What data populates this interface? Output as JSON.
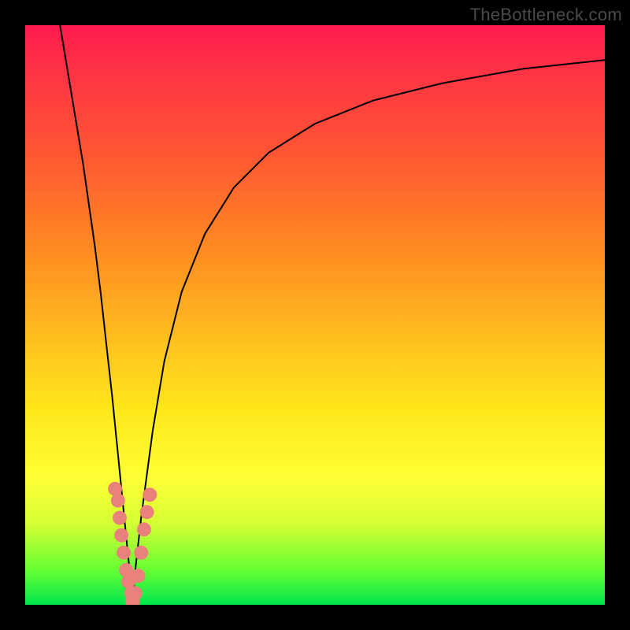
{
  "watermark": "TheBottleneck.com",
  "colors": {
    "gradient_top": "#ff1a4d",
    "gradient_mid1": "#ff8822",
    "gradient_mid2": "#ffe61a",
    "gradient_bottom": "#00e64d",
    "curve": "#000000",
    "marker": "#e8817c",
    "frame": "#000000"
  },
  "chart_data": {
    "type": "line",
    "title": "",
    "xlabel": "",
    "ylabel": "",
    "xlim": [
      0,
      100
    ],
    "ylim": [
      0,
      100
    ],
    "series": [
      {
        "name": "left-branch",
        "x": [
          6,
          8,
          10,
          12,
          13,
          14,
          15,
          16,
          17,
          18,
          18.5
        ],
        "values": [
          100,
          88,
          76,
          62,
          54,
          45,
          36,
          26,
          16,
          6,
          0
        ]
      },
      {
        "name": "right-branch",
        "x": [
          18.5,
          19,
          20,
          22,
          24,
          27,
          31,
          36,
          42,
          50,
          60,
          72,
          86,
          100
        ],
        "values": [
          0,
          6,
          15,
          30,
          42,
          54,
          64,
          72,
          78,
          83,
          87,
          90,
          92.5,
          94
        ]
      }
    ],
    "markers": [
      {
        "x": 15.5,
        "y": 20
      },
      {
        "x": 16.0,
        "y": 18
      },
      {
        "x": 16.3,
        "y": 15
      },
      {
        "x": 16.6,
        "y": 12
      },
      {
        "x": 17.0,
        "y": 9
      },
      {
        "x": 17.4,
        "y": 6
      },
      {
        "x": 17.8,
        "y": 4
      },
      {
        "x": 18.3,
        "y": 2
      },
      {
        "x": 18.5,
        "y": 0.5
      },
      {
        "x": 19.0,
        "y": 2
      },
      {
        "x": 19.5,
        "y": 5
      },
      {
        "x": 20.0,
        "y": 9
      },
      {
        "x": 20.5,
        "y": 13
      },
      {
        "x": 21.0,
        "y": 16
      },
      {
        "x": 21.5,
        "y": 19
      }
    ],
    "marker_radius_px": 9
  }
}
